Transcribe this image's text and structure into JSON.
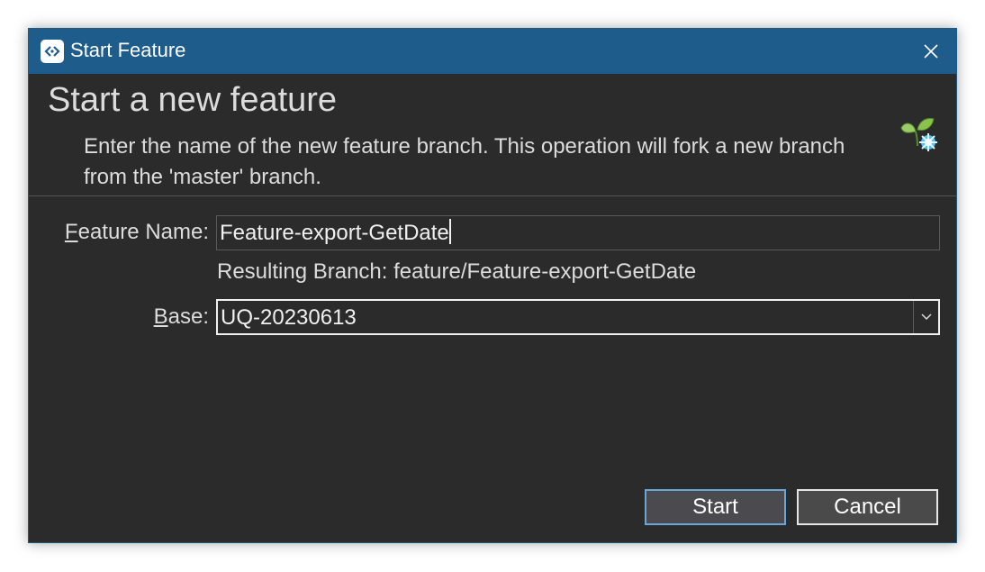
{
  "window": {
    "title": "Start Feature",
    "app_icon": "sourcetree-icon",
    "close_icon": "close-icon"
  },
  "header": {
    "title": "Start a new feature",
    "description": "Enter the name of the new feature branch. This operation will fork a new branch from the 'master' branch.",
    "icon": "feature-leaf-icon"
  },
  "form": {
    "feature_name": {
      "label_accel": "F",
      "label_rest": "eature Name:",
      "value": "Feature-export-GetDate"
    },
    "resulting_branch": "Resulting Branch: feature/Feature-export-GetDate",
    "base": {
      "label_accel": "B",
      "label_rest": "ase:",
      "value": "UQ-20230613"
    }
  },
  "buttons": {
    "start_label": "Start",
    "cancel_label": "Cancel"
  },
  "colors": {
    "titlebar": "#1e5c8c",
    "background": "#2b2b2b",
    "focus_border": "#6aa6d8"
  }
}
